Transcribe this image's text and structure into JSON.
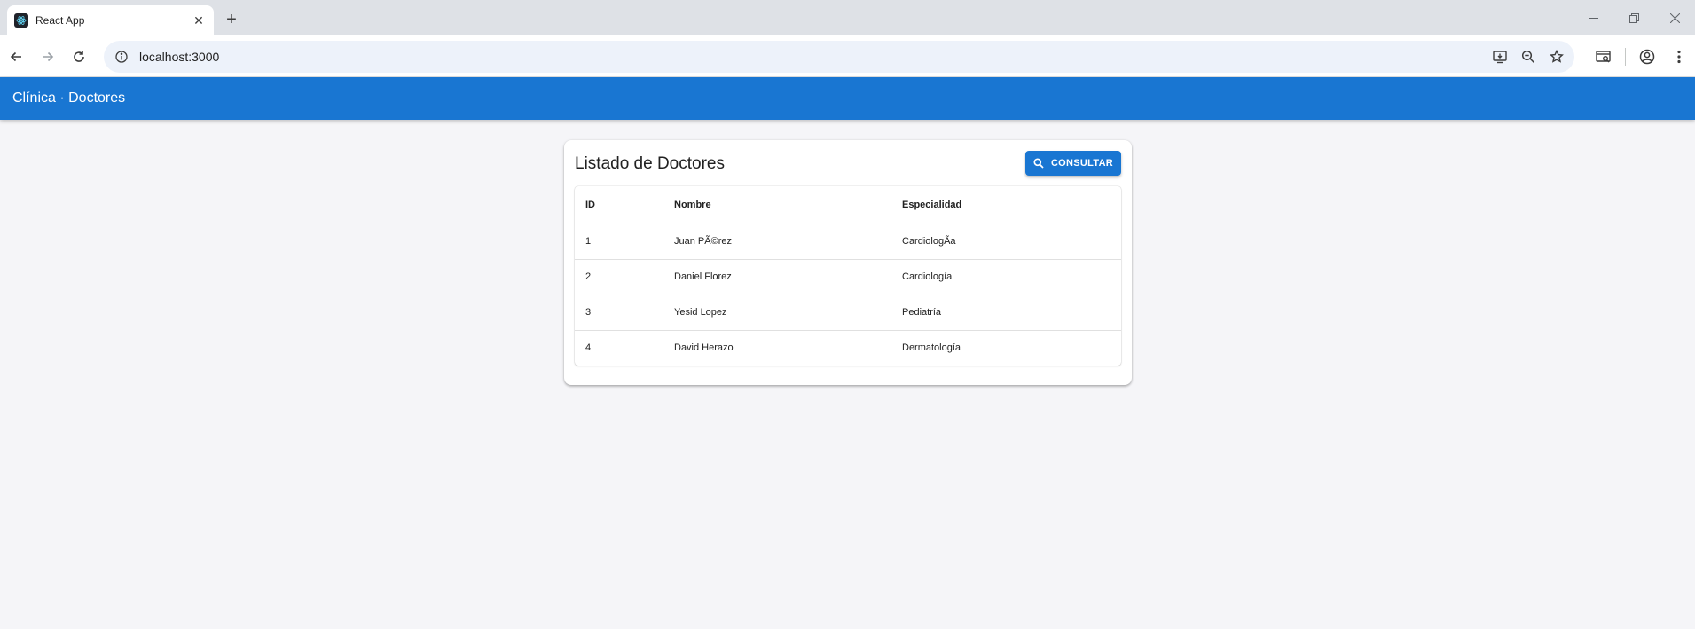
{
  "browser": {
    "tab_title": "React App",
    "url": "localhost:3000"
  },
  "app": {
    "title": "Clínica · Doctores"
  },
  "card": {
    "title": "Listado de Doctores",
    "consultar_label": "CONSULTAR"
  },
  "table": {
    "headers": {
      "id": "ID",
      "nombre": "Nombre",
      "especialidad": "Especialidad"
    },
    "rows": [
      {
        "id": "1",
        "nombre": "Juan PÃ©rez",
        "especialidad": "CardiologÃ­a"
      },
      {
        "id": "2",
        "nombre": "Daniel Florez",
        "especialidad": "Cardiología"
      },
      {
        "id": "3",
        "nombre": "Yesid Lopez",
        "especialidad": "Pediatría"
      },
      {
        "id": "4",
        "nombre": "David Herazo",
        "especialidad": "Dermatología"
      }
    ]
  },
  "colors": {
    "primary": "#1976d2",
    "background": "#f5f5f8"
  }
}
